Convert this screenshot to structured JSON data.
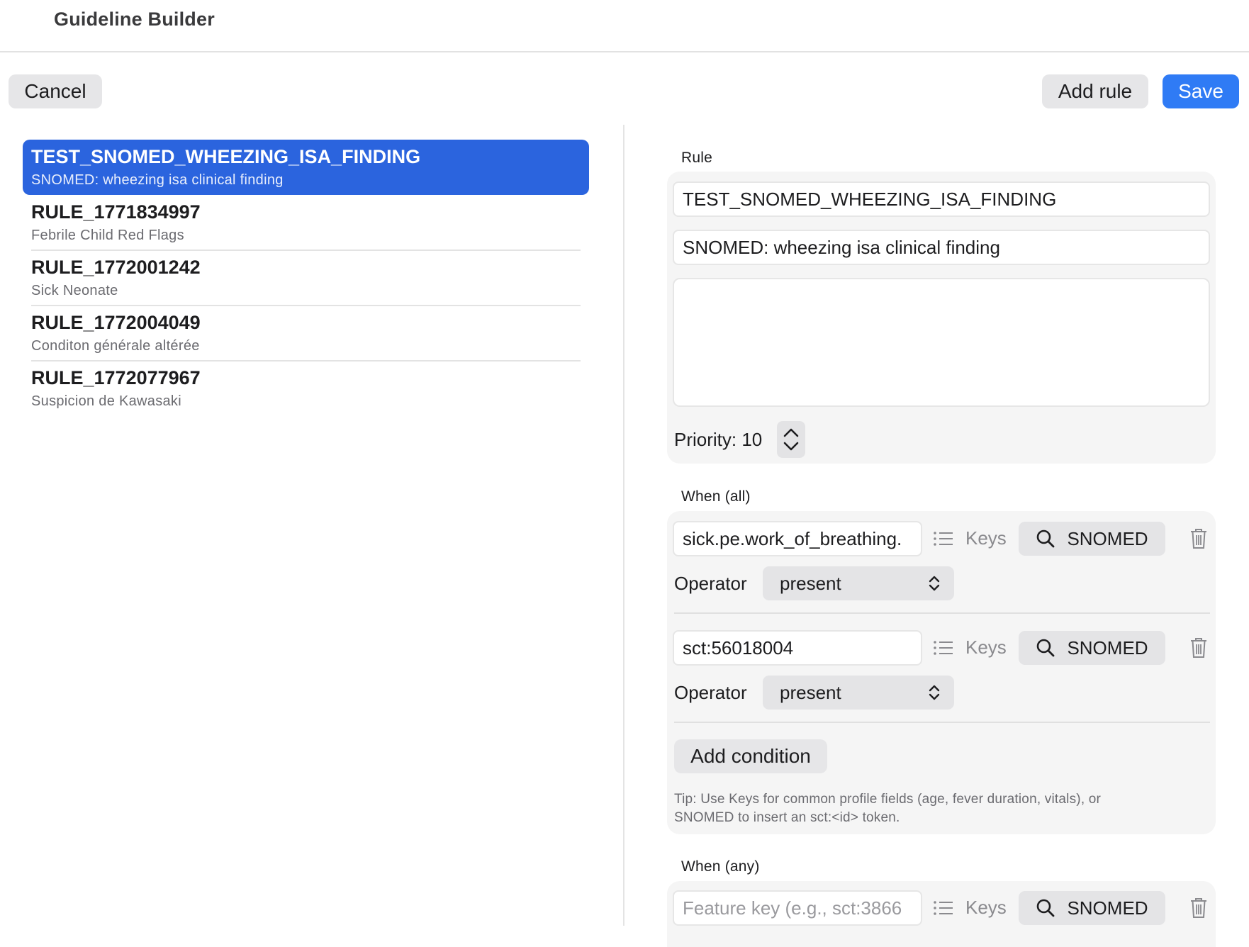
{
  "window": {
    "title": "Guideline Builder"
  },
  "toolbar": {
    "cancel_label": "Cancel",
    "add_rule_label": "Add rule",
    "save_label": "Save"
  },
  "rules": [
    {
      "id": "TEST_SNOMED_WHEEZING_ISA_FINDING",
      "description": "SNOMED: wheezing isa clinical finding",
      "selected": true
    },
    {
      "id": "RULE_1771834997",
      "description": "Febrile Child Red Flags"
    },
    {
      "id": "RULE_1772001242",
      "description": "Sick Neonate"
    },
    {
      "id": "RULE_1772004049",
      "description": "Conditon générale altérée"
    },
    {
      "id": "RULE_1772077967",
      "description": "Suspicion de Kawasaki"
    }
  ],
  "editor": {
    "rule_label": "Rule",
    "rule_id": "TEST_SNOMED_WHEEZING_ISA_FINDING",
    "rule_description": "SNOMED: wheezing isa clinical finding",
    "notes": "",
    "priority_text": "Priority: 10",
    "when_all_label": "When (all)",
    "conditions_all": [
      {
        "feature_key": "sick.pe.work_of_breathing.",
        "keys_label": "Keys",
        "snomed_label": "SNOMED",
        "operator_label": "Operator",
        "operator_value": "present"
      },
      {
        "feature_key": "sct:56018004",
        "keys_label": "Keys",
        "snomed_label": "SNOMED",
        "operator_label": "Operator",
        "operator_value": "present"
      }
    ],
    "add_condition_label": "Add condition",
    "tip_line1": "Tip: Use Keys for common profile fields (age, fever duration, vitals), or",
    "tip_line2": "SNOMED to insert an sct:<id> token.",
    "when_any_label": "When (any)",
    "conditions_any": [
      {
        "placeholder": "Feature key (e.g., sct:3866",
        "keys_label": "Keys",
        "snomed_label": "SNOMED"
      }
    ]
  },
  "colors": {
    "accent": "#2f7bf5",
    "selection": "#2b64de",
    "group_bg": "#f5f5f5"
  },
  "icons": [
    "list-icon",
    "search-icon",
    "trash-icon",
    "chevron-up-icon",
    "chevron-down-icon",
    "up-down-chevron-icon"
  ]
}
